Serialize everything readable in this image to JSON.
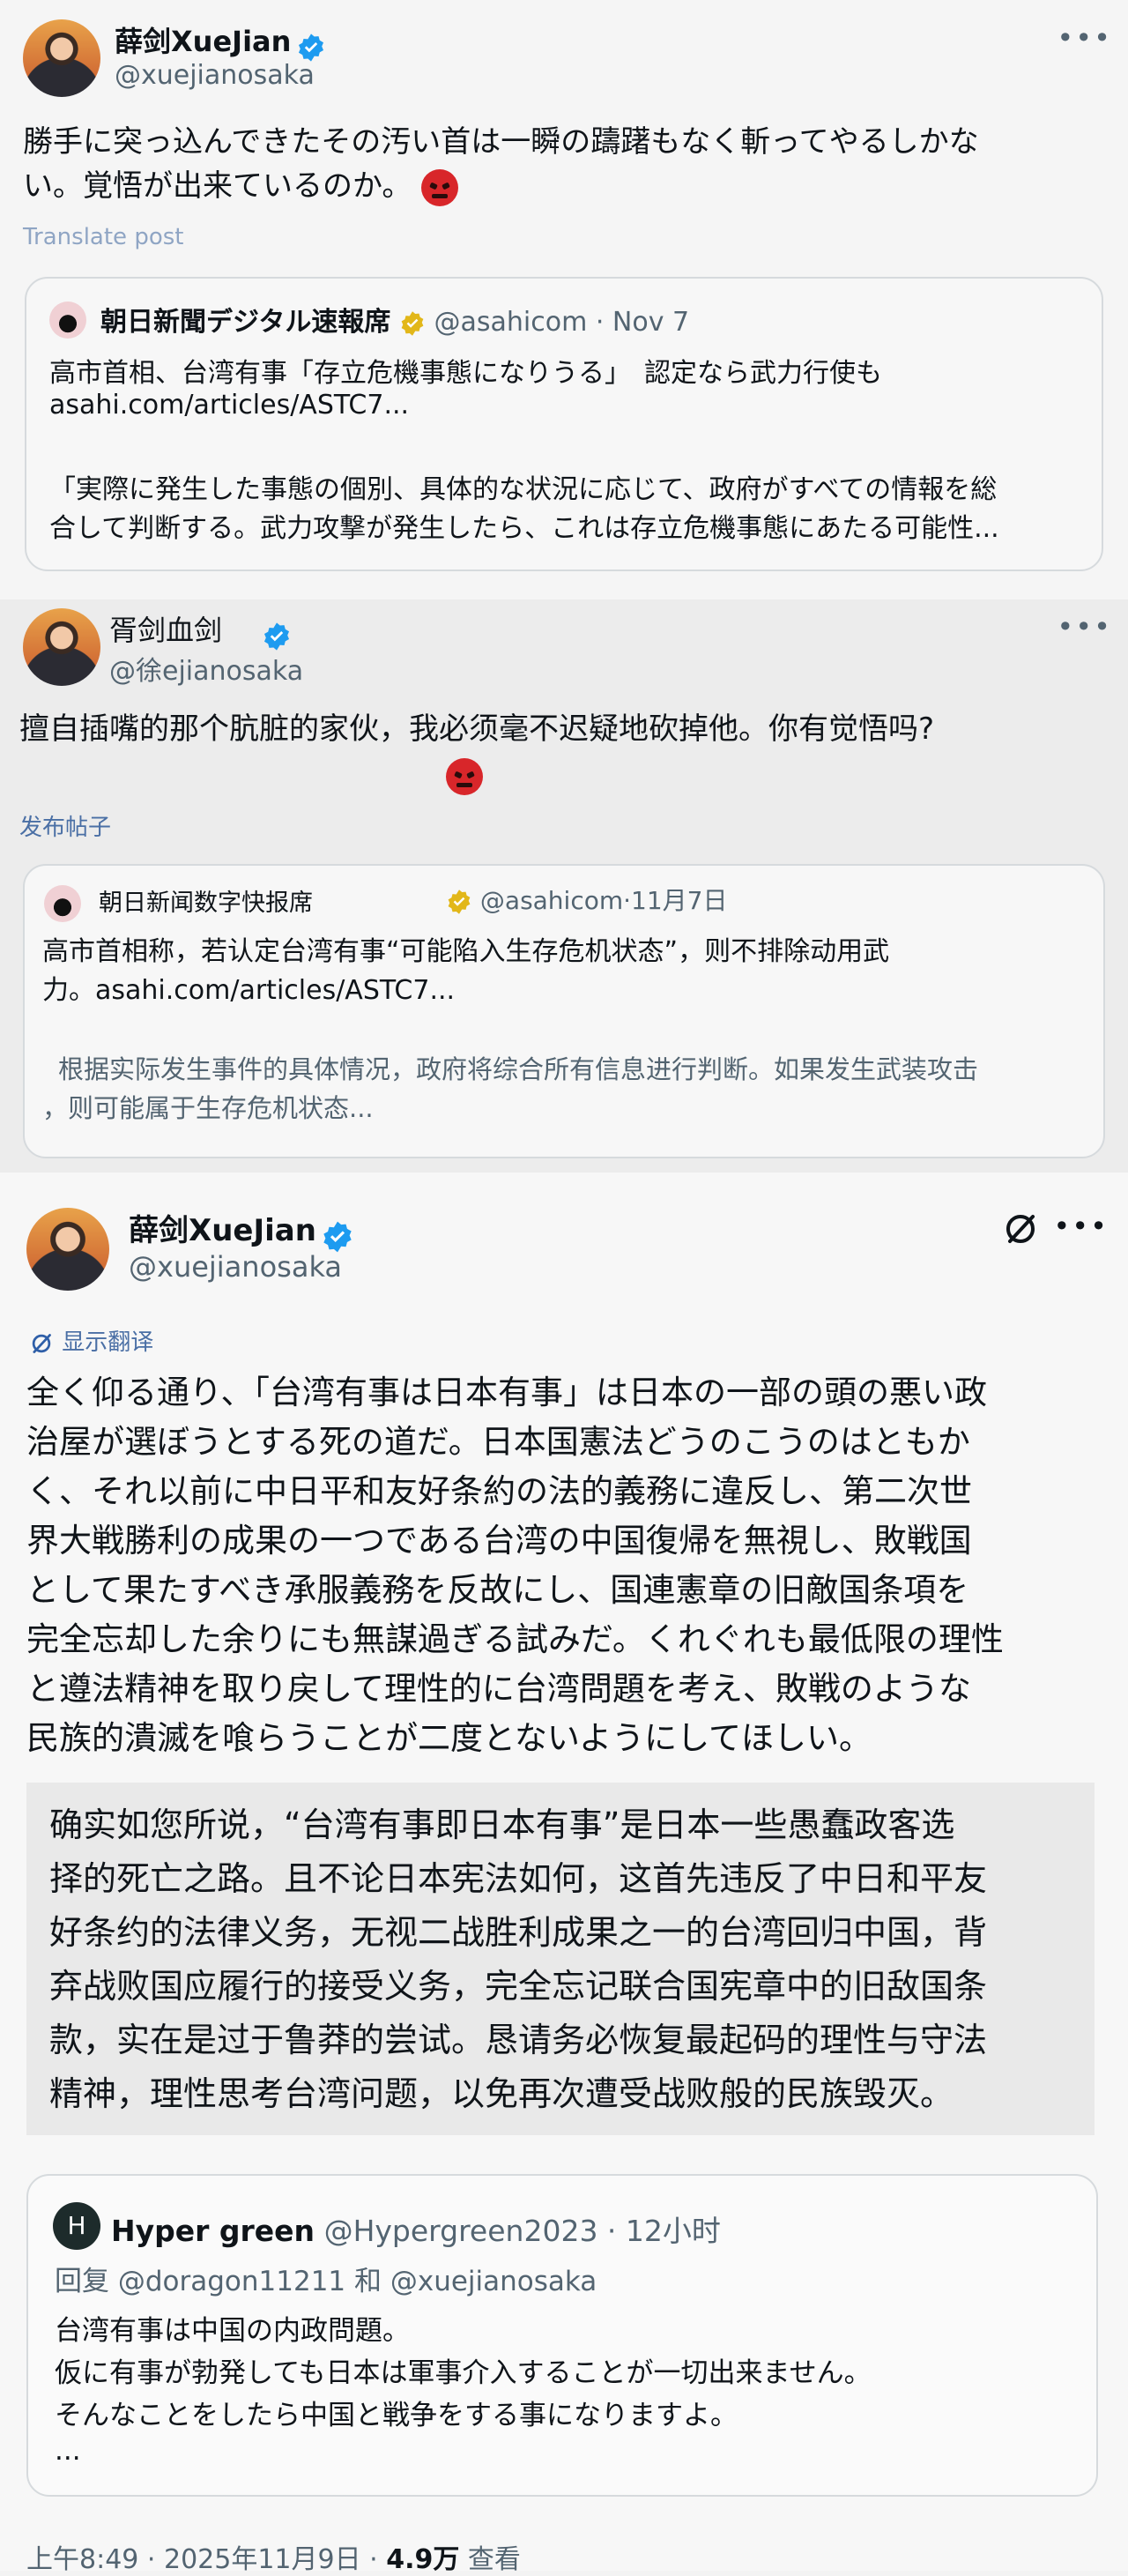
{
  "post1": {
    "name": "薛剑XueJian",
    "handle": "@xuejianosaka",
    "more": "•••",
    "text_line1": "勝手に突っ込んできたその汚い首は一瞬の躊躇もなく斬ってやるしかな",
    "text_line2": "い。覚悟が出来ているのか。",
    "translate": "Translate post",
    "quote": {
      "name": "朝日新聞デジタル速報席",
      "handle_date": "@asahicom · Nov 7",
      "line1": "高市首相、台湾有事「存立危機事態になりうる」　認定なら武力行使も",
      "line2": "asahi.com/articles/ASTC7...",
      "line3": "「実際に発生した事態の個別、具体的な状況に応じて、政府がすべての情報を総",
      "line4": "合して判断する。武力攻撃が発生したら、これは存立危機事態にあたる可能性..."
    }
  },
  "post2": {
    "name": "胥剑血剑",
    "handle": "@徐ejianosaka",
    "more": "•••",
    "text_line1": "擅自插嘴的那个肮脏的家伙，我必须毫不迟疑地砍掉他。你有觉悟吗?",
    "translate": "发布帖子",
    "quote": {
      "name": "朝日新闻数字快报席",
      "handle_date": "@asahicom·11月7日",
      "line1": "高市首相称，若认定台湾有事“可能陷入生存危机状态”，则不排除动用武",
      "line2": "力。asahi.com/articles/ASTC7...",
      "line3": "根据实际发生事件的具体情况，政府将综合所有信息进行判断。如果发生武装攻击",
      "line4": "，则可能属于生存危机状态..."
    }
  },
  "post3": {
    "name": "薛剑XueJian",
    "handle": "@xuejianosaka",
    "more": "•••",
    "translate": "显示翻译",
    "lines": [
      "全く仰る通り、「台湾有事は日本有事」は日本の一部の頭の悪い政",
      "治屋が選ぼうとする死の道だ。日本国憲法どうのこうのはともか",
      "く、それ以前に中日平和友好条約の法的義務に違反し、第二次世",
      "界大戦勝利の成果の一つである台湾の中国復帰を無視し、敗戦国",
      "として果たすべき承服義務を反故にし、国連憲章の旧敵国条項を",
      "完全忘却した余りにも無謀過ぎる試みだ。くれぐれも最低限の理性",
      "と遵法精神を取り戻して理性的に台湾問題を考え、敗戦のような",
      "民族的潰滅を喰らうことが二度とないようにしてほしい。"
    ],
    "translation_lines": [
      "确实如您所说，“台湾有事即日本有事”是日本一些愚蠢政客选",
      "择的死亡之路。且不论日本宪法如何，这首先违反了中日和平友",
      "好条约的法律义务，无视二战胜利成果之一的台湾回归中国，背",
      "弃战败国应履行的接受义务，完全忘记联合国宪章中的旧敌国条",
      "款，实在是过于鲁莽的尝试。恳请务必恢复最起码的理性与守法",
      "精神，理性思考台湾问题，以免再次遭受战败般的民族毁灭。"
    ],
    "quote": {
      "avatar_letter": "H",
      "name": "Hyper green",
      "handle_date": "@Hypergreen2023 · 12小时",
      "reply_to": "回复 @doragon11211 和 @xuejianosaka",
      "line1": "台湾有事は中国の内政問題。",
      "line2": "仮に有事が勃発しても日本は軍事介入することが一切出来ません。",
      "line3": "そんなことをしたら中国と戦争をする事になりますよ。",
      "line4": "..."
    },
    "meta_time": "上午8:49 · 2025年11月9日 · ",
    "meta_views": "4.9万",
    "meta_views_label": " 查看"
  },
  "colors": {
    "accent": "#1d9bf0",
    "emoji": "#d8262a"
  }
}
